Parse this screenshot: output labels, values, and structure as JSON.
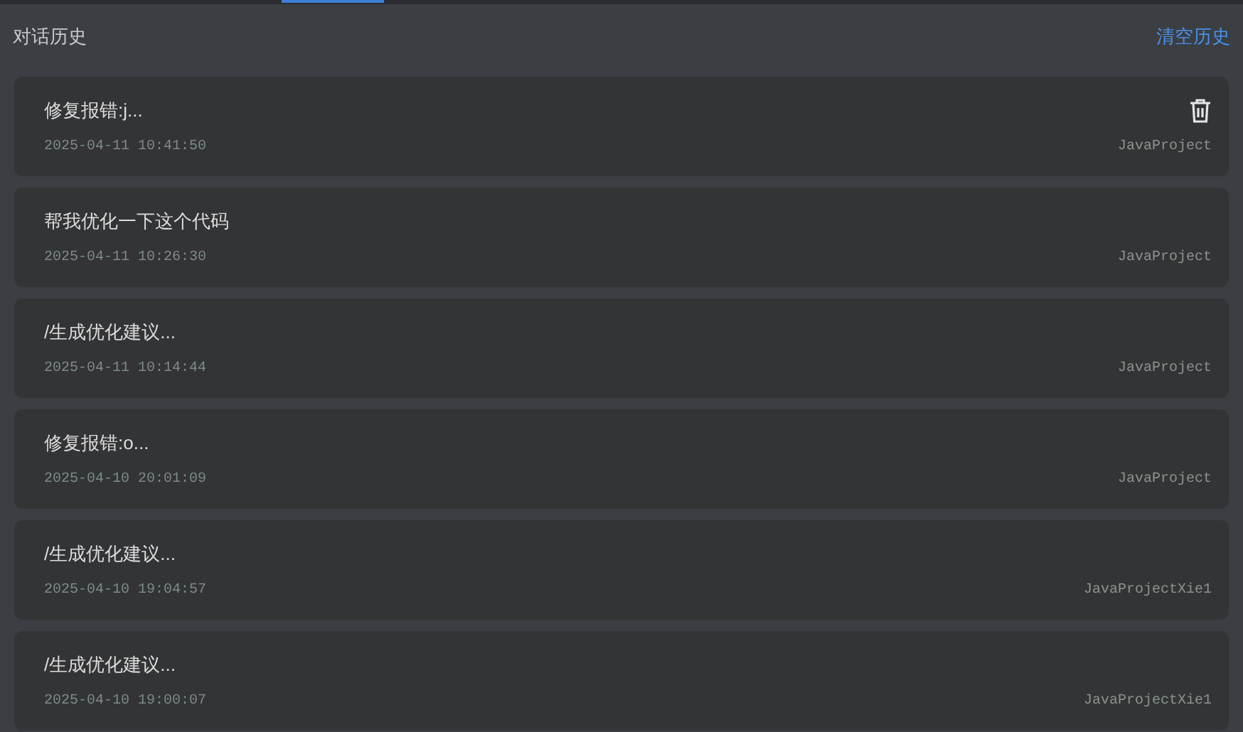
{
  "tab_indicator": {
    "selected": true
  },
  "header": {
    "title": "对话历史",
    "clear_link": "清空历史"
  },
  "conversations": [
    {
      "title": "修复报错:j...",
      "time": "2025-04-11 10:41:50",
      "project": "JavaProject",
      "hovered": true
    },
    {
      "title": "帮我优化一下这个代码",
      "time": "2025-04-11 10:26:30",
      "project": "JavaProject",
      "hovered": false
    },
    {
      "title": "/生成优化建议...",
      "time": "2025-04-11 10:14:44",
      "project": "JavaProject",
      "hovered": false
    },
    {
      "title": "修复报错:o...",
      "time": "2025-04-10 20:01:09",
      "project": "JavaProject",
      "hovered": false
    },
    {
      "title": "/生成优化建议...",
      "time": "2025-04-10 19:04:57",
      "project": "JavaProjectXie1",
      "hovered": false
    },
    {
      "title": "/生成优化建议...",
      "time": "2025-04-10 19:00:07",
      "project": "JavaProjectXie1",
      "hovered": false
    }
  ]
}
